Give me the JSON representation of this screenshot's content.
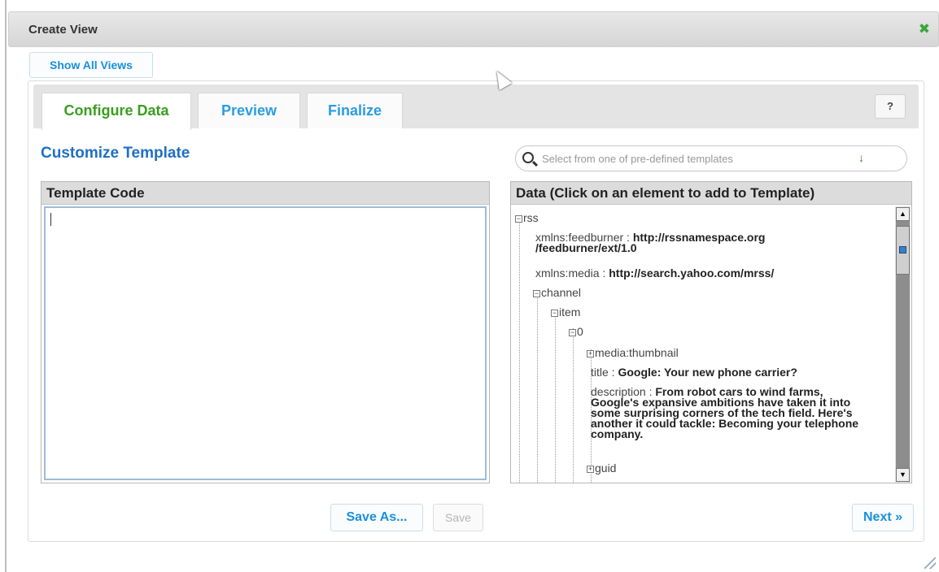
{
  "dialog": {
    "title": "Create View",
    "close_icon": "close-icon"
  },
  "show_all_label": "Show All Views",
  "tabs": [
    {
      "label": "Configure Data",
      "active": true
    },
    {
      "label": "Preview",
      "active": false
    },
    {
      "label": "Finalize",
      "active": false
    }
  ],
  "help_label": "?",
  "section_title": "Customize Template",
  "search": {
    "placeholder": "Select from one of pre-defined templates",
    "icon": "search-icon",
    "dropdown_glyph": "↓"
  },
  "template_code": {
    "header": "Template Code",
    "value": ""
  },
  "data_panel": {
    "header": "Data (Click on an element to add to Template)",
    "tree": {
      "rss": "rss",
      "feedburner_key": "xmlns:feedburner : ",
      "feedburner_val_1": "http://rssnamespace.org",
      "feedburner_val_2": "/feedburner/ext/1.0",
      "media_key": "xmlns:media : ",
      "media_val": "http://search.yahoo.com/mrss/",
      "channel": "channel",
      "item": "item",
      "zero": "0",
      "thumbnail": "media:thumbnail",
      "title_key": "title : ",
      "title_val": "Google: Your new phone carrier?",
      "desc_key": "description : ",
      "desc_val": "From robot cars to wind farms, Google's expansive ambitions have taken it into some surprising corners of the tech field. Here's another it could tackle: Becoming your telephone company.",
      "guid": "guid"
    }
  },
  "buttons": {
    "save_as": "Save As...",
    "save": "Save",
    "next": "Next »"
  },
  "colors": {
    "accent_blue": "#1a8fdc",
    "active_tab_green": "#3a9e1e",
    "heading_blue": "#1f6fc4"
  }
}
